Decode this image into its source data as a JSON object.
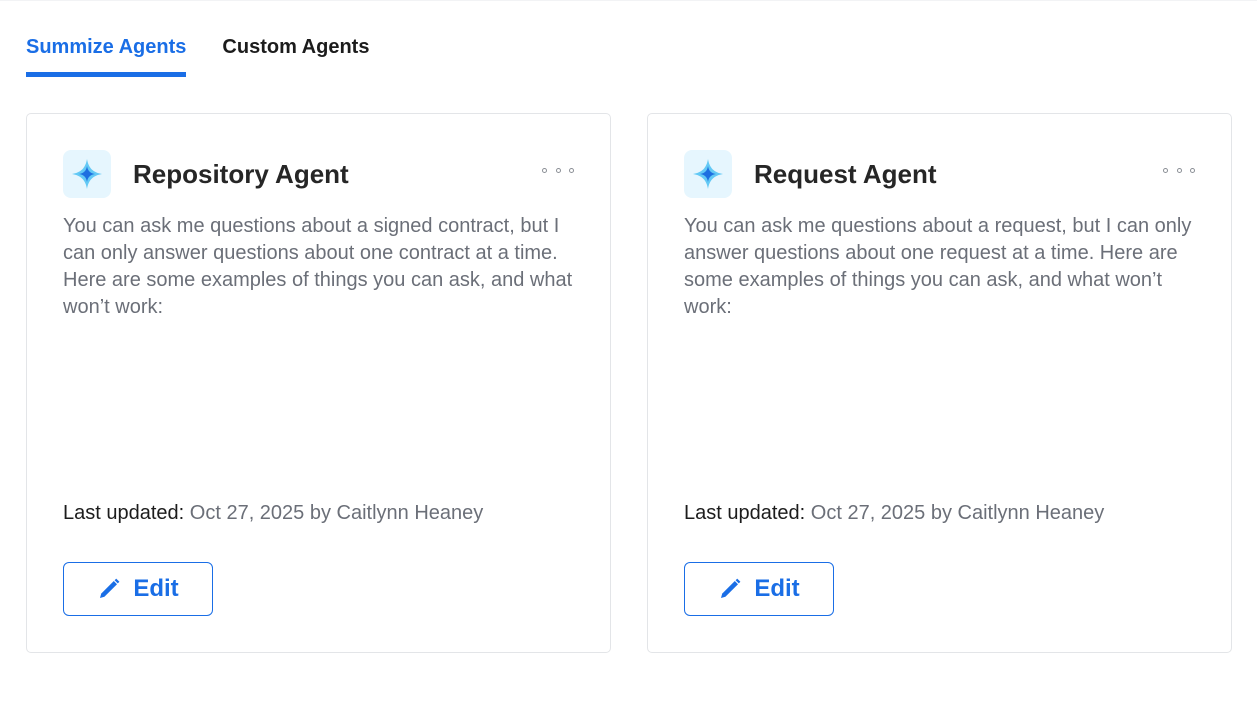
{
  "tabs": [
    {
      "label": "Summize Agents",
      "active": true
    },
    {
      "label": "Custom Agents",
      "active": false
    }
  ],
  "colors": {
    "accent": "#1a6ee6",
    "icon_bg": "#e6f6fe",
    "icon_star_light": "#63c9f5",
    "icon_star_dark": "#1e6fe0"
  },
  "cards": [
    {
      "icon": "sparkle-star-icon",
      "title": "Repository Agent",
      "description": "You can ask me questions about a signed contract, but I can only answer questions about one contract at a time. Here are some examples of things you can ask, and what won’t work:",
      "last_updated_label": "Last updated:",
      "last_updated_value": "Oct 27, 2025 by Caitlynn Heaney",
      "edit_label": "Edit",
      "menu_icon": "more-horizontal-icon"
    },
    {
      "icon": "sparkle-star-icon",
      "title": "Request Agent",
      "description": "You can ask me questions about a request, but I can only answer questions about one request at a time. Here are some examples of things you can ask, and what won’t work:",
      "last_updated_label": "Last updated:",
      "last_updated_value": "Oct 27, 2025 by Caitlynn Heaney",
      "edit_label": "Edit",
      "menu_icon": "more-horizontal-icon"
    }
  ]
}
